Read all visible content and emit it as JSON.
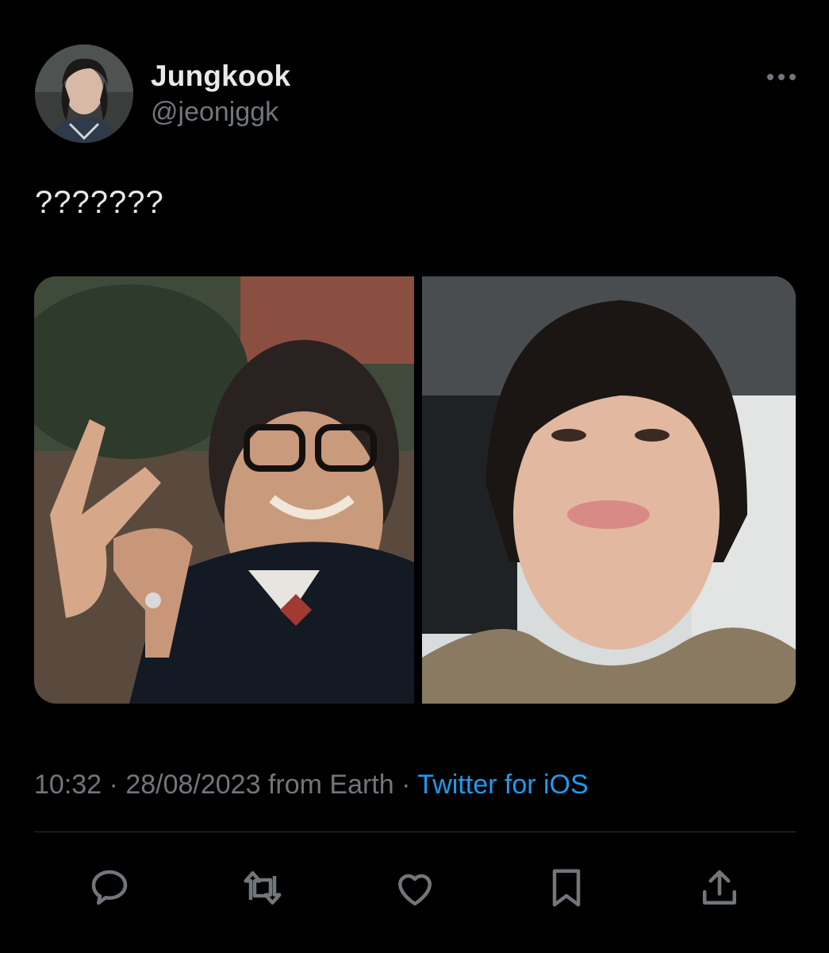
{
  "author": {
    "display_name": "Jungkook",
    "handle": "@jeonjggk"
  },
  "tweet": {
    "text": "???????",
    "time": "10:32",
    "date": "28/08/2023",
    "location": "from Earth",
    "separator": "·",
    "source": "Twitter for iOS"
  },
  "media": {
    "count": 2,
    "photos": [
      "photo-1",
      "photo-2"
    ]
  },
  "icons": {
    "more": "more-horizontal-icon",
    "reply": "reply-bubble-icon",
    "retweet": "retweet-icon",
    "like": "heart-icon",
    "bookmark": "bookmark-icon",
    "share": "share-upload-icon"
  },
  "colors": {
    "background": "#000000",
    "primary_text": "#e7e9ea",
    "secondary_text": "#71767b",
    "accent": "#1d9bf0",
    "divider": "#2f3336"
  }
}
